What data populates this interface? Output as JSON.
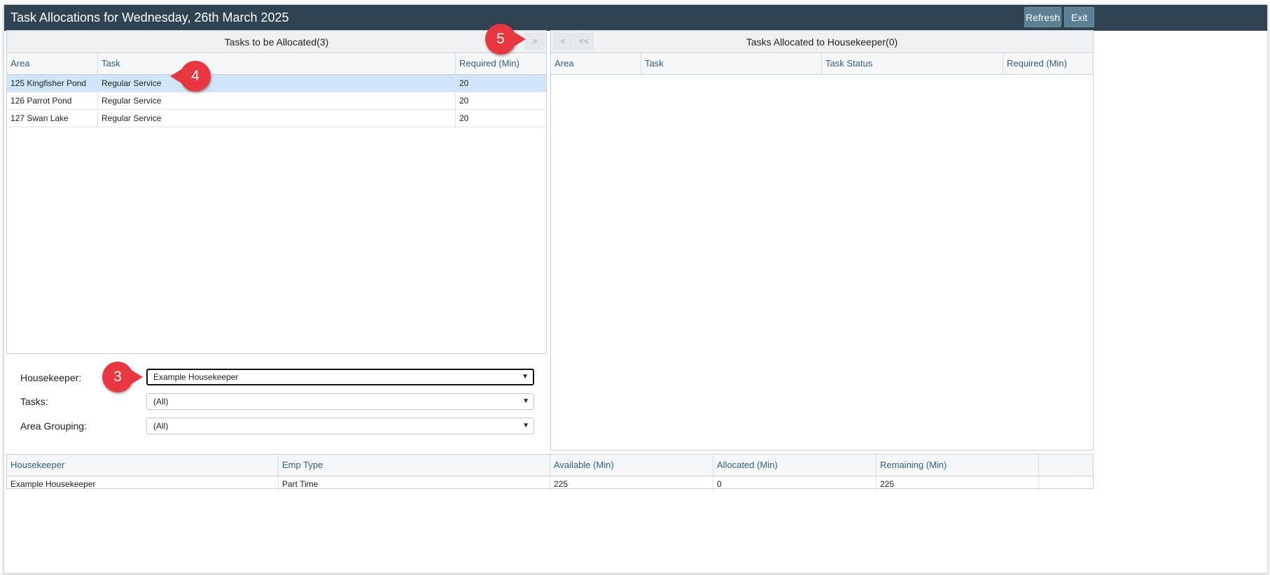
{
  "window": {
    "title": "Task Allocations for Wednesday, 26th March 2025",
    "refresh_label": "Refresh",
    "exit_label": "Exit"
  },
  "left_panel": {
    "title": "Tasks to be Allocated(3)",
    "move_right_label": ">",
    "columns": [
      "Area",
      "Task",
      "Required (Min)"
    ],
    "rows": [
      {
        "area": "125 Kingfisher Pond",
        "task": "Regular Service",
        "required": "20",
        "selected": true
      },
      {
        "area": "126 Parrot Pond",
        "task": "Regular Service",
        "required": "20",
        "selected": false
      },
      {
        "area": "127 Swan Lake",
        "task": "Regular Service",
        "required": "20",
        "selected": false
      }
    ]
  },
  "right_panel": {
    "title": "Tasks Allocated to Housekeeper(0)",
    "move_left_label": "<",
    "move_all_left_label": "<<",
    "columns": [
      "Area",
      "Task",
      "Task Status",
      "Required (Min)"
    ],
    "rows": []
  },
  "filters": {
    "housekeeper_label": "Housekeeper:",
    "housekeeper_value": "Example Housekeeper",
    "tasks_label": "Tasks:",
    "tasks_value": "(All)",
    "area_grouping_label": "Area Grouping:",
    "area_grouping_value": "(All)"
  },
  "summary": {
    "columns": [
      "Housekeeper",
      "Emp Type",
      "Available (Min)",
      "Allocated (Min)",
      "Remaining (Min)"
    ],
    "rows": [
      {
        "housekeeper": "Example Housekeeper",
        "emp_type": "Part Time",
        "available": "225",
        "allocated": "0",
        "remaining": "225"
      }
    ]
  },
  "callouts": {
    "step3": "3",
    "step4": "4",
    "step5": "5"
  },
  "icons": {
    "dropdown": "chevron-down-icon"
  },
  "colors": {
    "titlebar": "#2f4353",
    "button": "#5c7f93",
    "header_text": "#2f5f80",
    "selected_row": "#cfe6fa",
    "callout": "#e8373e"
  }
}
